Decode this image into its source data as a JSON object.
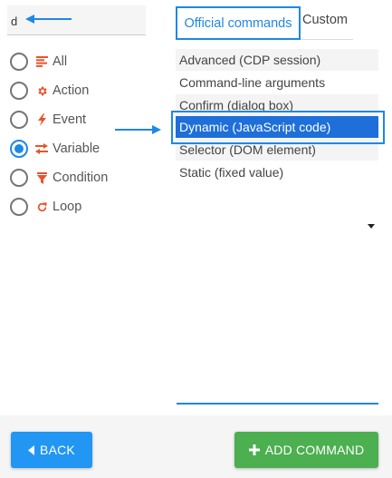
{
  "search": {
    "value": "d",
    "placeholder": ""
  },
  "filters": [
    {
      "label": "All",
      "icon": "list-icon",
      "color": "#e8542c",
      "checked": false
    },
    {
      "label": "Action",
      "icon": "gear-icon",
      "color": "#e8542c",
      "checked": false
    },
    {
      "label": "Event",
      "icon": "bolt-icon",
      "color": "#e8542c",
      "checked": false
    },
    {
      "label": "Variable",
      "icon": "swap-arrows-icon",
      "color": "#e8542c",
      "checked": true
    },
    {
      "label": "Condition",
      "icon": "filter-icon",
      "color": "#e8542c",
      "checked": false
    },
    {
      "label": "Loop",
      "icon": "refresh-icon",
      "color": "#e8542c",
      "checked": false
    }
  ],
  "tabs": {
    "official": "Official commands",
    "custom": "Custom"
  },
  "commands": [
    "Advanced (CDP session)",
    "Command-line arguments",
    "Confirm (dialog box)",
    "Dynamic (JavaScript code)",
    "Selector (DOM element)",
    "Static (fixed value)"
  ],
  "selected_command_index": 3,
  "buttons": {
    "back": "BACK",
    "add": "ADD COMMAND"
  },
  "colors": {
    "accent": "#1e88e5",
    "selected_row": "#1e6fd9",
    "add_button": "#4caf50",
    "back_button": "#2196f3",
    "icon_orange": "#e8542c"
  }
}
